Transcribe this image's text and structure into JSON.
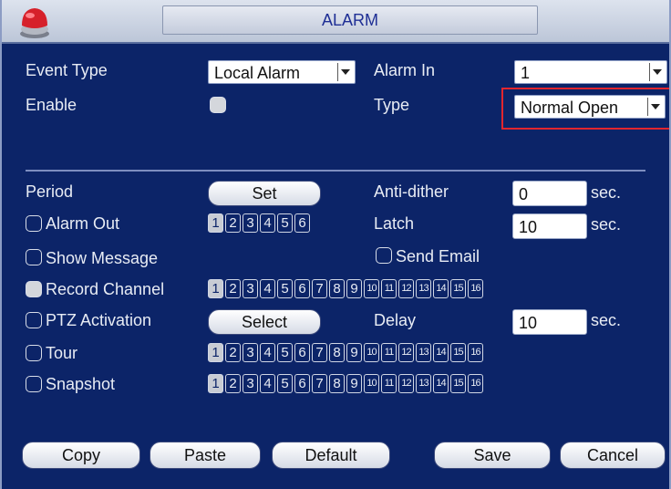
{
  "window": {
    "title": "ALARM",
    "colors": {
      "background": "#0c2468",
      "titlebar": "#cdd4e2",
      "title_text": "#1f2f95",
      "highlight": "#e2262e"
    }
  },
  "form": {
    "event_type": {
      "label": "Event Type",
      "value": "Local Alarm"
    },
    "alarm_in": {
      "label": "Alarm In",
      "value": "1"
    },
    "enable": {
      "label": "Enable",
      "checked": true
    },
    "type": {
      "label": "Type",
      "value": "Normal Open"
    },
    "period": {
      "label": "Period",
      "button": "Set"
    },
    "anti_dither": {
      "label": "Anti-dither",
      "value": "0",
      "unit": "sec."
    },
    "alarm_out": {
      "label": "Alarm Out",
      "checked": false,
      "channels": [
        "1",
        "2",
        "3",
        "4",
        "5",
        "6"
      ],
      "selected": [
        "1"
      ]
    },
    "latch": {
      "label": "Latch",
      "value": "10",
      "unit": "sec."
    },
    "show_message": {
      "label": "Show Message",
      "checked": false
    },
    "send_email": {
      "label": "Send Email",
      "checked": false
    },
    "record_channel": {
      "label": "Record Channel",
      "checked": true,
      "channels": [
        "1",
        "2",
        "3",
        "4",
        "5",
        "6",
        "7",
        "8",
        "9",
        "10",
        "11",
        "12",
        "13",
        "14",
        "15",
        "16"
      ],
      "selected": [
        "1"
      ]
    },
    "ptz_activation": {
      "label": "PTZ Activation",
      "checked": false,
      "button": "Select"
    },
    "delay": {
      "label": "Delay",
      "value": "10",
      "unit": "sec."
    },
    "tour": {
      "label": "Tour",
      "checked": false,
      "channels": [
        "1",
        "2",
        "3",
        "4",
        "5",
        "6",
        "7",
        "8",
        "9",
        "10",
        "11",
        "12",
        "13",
        "14",
        "15",
        "16"
      ],
      "selected": [
        "1"
      ]
    },
    "snapshot": {
      "label": "Snapshot",
      "checked": false,
      "channels": [
        "1",
        "2",
        "3",
        "4",
        "5",
        "6",
        "7",
        "8",
        "9",
        "10",
        "11",
        "12",
        "13",
        "14",
        "15",
        "16"
      ],
      "selected": [
        "1"
      ]
    }
  },
  "footer": {
    "copy": "Copy",
    "paste": "Paste",
    "default": "Default",
    "save": "Save",
    "cancel": "Cancel"
  }
}
